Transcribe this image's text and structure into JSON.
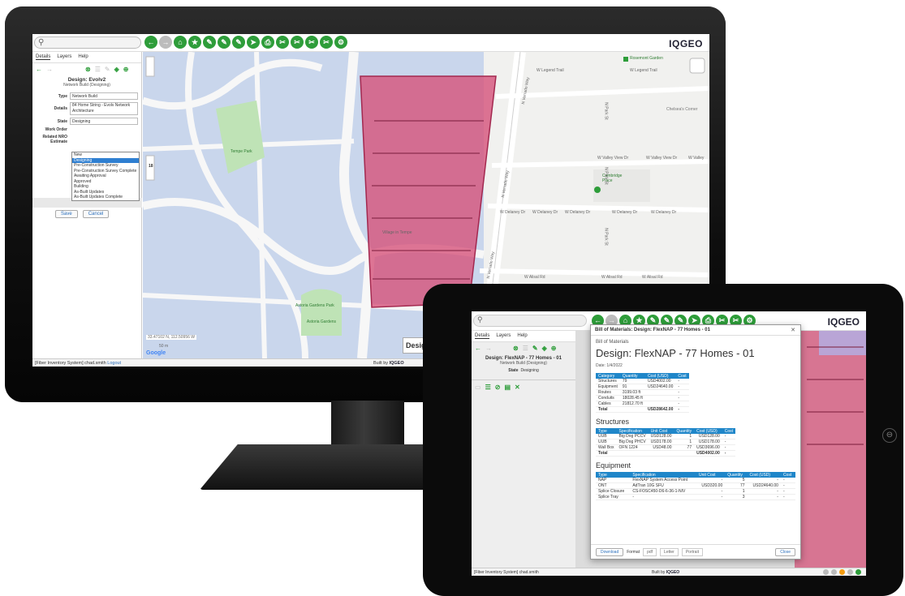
{
  "desktop": {
    "brand": "IQGEO",
    "search_glyph": "⚲",
    "tool_icons": [
      "←",
      "→",
      "⌂",
      "★",
      "✎",
      "✎",
      "✎",
      "➤",
      "⎙",
      "✂",
      "✂",
      "✂",
      "✂",
      "⚙"
    ],
    "panel": {
      "tabs": [
        "Details",
        "Layers",
        "Help"
      ],
      "title": "Design: Evolv2",
      "subtitle": "Network Build (Designing)",
      "fields": {
        "type_label": "Type",
        "type_value": "Network Build",
        "details_label": "Details",
        "details_value": "84 Home String - Evolv Network Architecture",
        "state_label": "State",
        "state_value": "Designing",
        "work_order_label": "Work Order",
        "related_label": "Related NRO Estimate"
      },
      "state_options": [
        "New",
        "Designing",
        "Pre-Construction Survey",
        "Pre-Construction Survey Complete",
        "Awaiting Approval",
        "Approved",
        "Building",
        "As-Built Updates",
        "As-Built Updates Complete"
      ],
      "state_selected": "Designing",
      "save_label": "Save",
      "cancel_label": "Cancel"
    },
    "map": {
      "labels": {
        "tempe_park": "Tempe Park",
        "astoria_park": "Astoria Gardens Park",
        "astoria_gardens": "Astoria Gardens",
        "rosemont": "Rosemont Garden",
        "chelseas": "Chelsea's Corner",
        "cambridge": "Cambridge Place",
        "village": "Village in Tempe",
        "legend_trail_1": "W Legend Trail",
        "legend_trail_2": "W Legend Trail",
        "valley_view_1": "W Valley View Dr",
        "valley_view_2": "W Valley View Dr",
        "valley_view_3": "W Valley",
        "delaney_1": "W Delaney Dr",
        "delaney_2": "W Delaney Dr",
        "delaney_3": "W Delaney Dr",
        "delaney_4": "W Delaney Dr",
        "delaney_5": "W Delaney Dr",
        "alisal_1": "W Alisal Rd",
        "alisal_2": "W Alisal Rd",
        "alisal_3": "W Alisal Rd",
        "verrado_1": "N Verrado Way",
        "verrado_2": "N Verrado Way",
        "verrado_3": "N Verrado Way",
        "park_st_1": "N Park St",
        "park_st_2": "N Park St",
        "park_st_3": "N Park St"
      },
      "coords": "33.47102 N, 112.50956 W",
      "scale": "50 m",
      "attribution": "Google",
      "design_label": "Design:",
      "zoom_level": "18"
    },
    "footer": {
      "system": "[Fiber Inventory System] chad.smith",
      "logout": "Logout",
      "built_by": "Built by",
      "built_brand": "IQGEO"
    }
  },
  "tablet": {
    "search_glyph": "⚲",
    "brand": "IQGEO",
    "tool_icons": [
      "←",
      "→",
      "⌂",
      "★",
      "✎",
      "✎",
      "✎",
      "➤",
      "⎙",
      "✂",
      "✂",
      "⚙"
    ],
    "panel": {
      "tabs": [
        "Details",
        "Layers",
        "Help"
      ],
      "title": "Design: FlexNAP - 77 Homes - 01",
      "subtitle": "Network Build (Designing)",
      "state_label": "State",
      "state_value": "Designing"
    },
    "footer": {
      "system": "[Fiber Inventory System] chad.smith",
      "built_by": "Built by",
      "built_brand": "IQGEO"
    },
    "modal": {
      "header": "Bill of Materials: Design: FlexNAP - 77 Homes - 01",
      "kicker": "Bill of Materials",
      "title": "Design: FlexNAP - 77 Homes - 01",
      "date": "Date: 1/4/2022",
      "summary": {
        "headers": [
          "Category",
          "Quantity",
          "Cost (USD)",
          "Cost"
        ],
        "rows": [
          [
            "Structures",
            "79",
            "USD4002.00",
            "-"
          ],
          [
            "Equipment",
            "91",
            "USD24640.00",
            "-"
          ],
          [
            "Routes",
            "3199.03 ft",
            "",
            "-"
          ],
          [
            "Conduits",
            "18028.45 ft",
            "",
            "-"
          ],
          [
            "Cables",
            "21812.70 ft",
            "",
            "-"
          ]
        ],
        "total": [
          "Total",
          "",
          "USD28642.00",
          "-"
        ]
      },
      "structures_title": "Structures",
      "structures": {
        "headers": [
          "Type",
          "Specification",
          "Unit Cost",
          "Quantity",
          "Cost (USD)",
          "Cost"
        ],
        "rows": [
          [
            "UUB",
            "Big Dog PCCV",
            "USD128.00",
            "1",
            "USD128.00",
            "-"
          ],
          [
            "UUB",
            "Big Dog PHCV",
            "USD178.00",
            "1",
            "USD178.00",
            "-"
          ],
          [
            "Wall Box",
            "OFN 1224",
            "USD48.00",
            "77",
            "USD3696.00",
            "-"
          ]
        ],
        "total": [
          "Total",
          "",
          "",
          "",
          "USD4002.00",
          "-"
        ]
      },
      "equipment_title": "Equipment",
      "equipment": {
        "headers": [
          "Type",
          "Specification",
          "Unit Cost",
          "Quantity",
          "Cost (USD)",
          "Cost"
        ],
        "rows": [
          [
            "NAP",
            "FlexNAP System Access Point",
            "-",
            "5",
            "-",
            "-"
          ],
          [
            "ONT",
            "AdTran 10G SFU",
            "USD320.00",
            "77",
            "USD24640.00",
            "-"
          ],
          [
            "Splice Closure",
            "CS-FOSC450-D6-6-36-1-NIV",
            "-",
            "1",
            "-",
            "-"
          ],
          [
            "Splice Tray",
            "-",
            "-",
            "3",
            "-",
            "-"
          ]
        ]
      },
      "download": "Download",
      "format_label": "Format",
      "format_value": "pdf",
      "paper_value": "Letter",
      "portrait_value": "Portrait",
      "close": "Close"
    }
  },
  "colors": {
    "accent": "#2e9d3a",
    "design_fill": "#d6537a",
    "parcel": "#c9d6ec",
    "park": "#bfe3b6"
  }
}
